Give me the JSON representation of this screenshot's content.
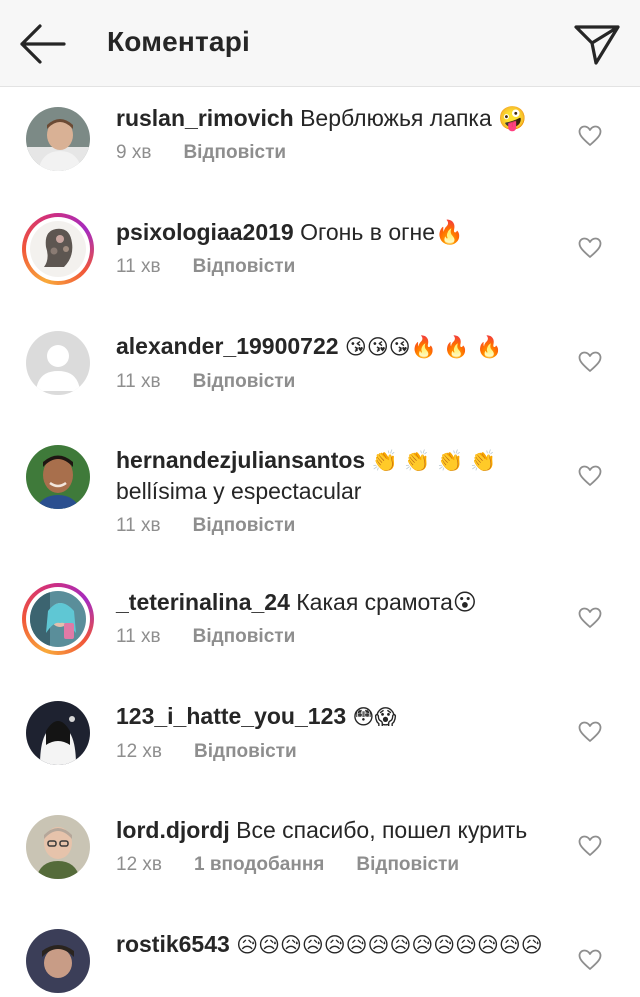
{
  "header": {
    "title": "Коментарі",
    "back_icon": "arrow-left-icon",
    "send_icon": "paper-plane-icon"
  },
  "comments": [
    {
      "username": "ruslan_rimovich",
      "text": "Верблюжья лапка 🤪",
      "time": "9 хв",
      "reply": "Відповісти",
      "likes": "",
      "story_ring": false,
      "avatar": "photo-avatar"
    },
    {
      "username": "psixologiaa2019",
      "text": "Огонь в огне🔥",
      "time": "11 хв",
      "reply": "Відповісти",
      "likes": "",
      "story_ring": true,
      "avatar": "photo-avatar"
    },
    {
      "username": "alexander_19900722",
      "text": "😘😘😘🔥 🔥 🔥",
      "time": "11 хв",
      "reply": "Відповісти",
      "likes": "",
      "story_ring": false,
      "avatar": "default-avatar"
    },
    {
      "username": "hernandezjuliansantos",
      "text": "👏 👏 👏 👏",
      "text2": "bellísima y espectacular",
      "time": "11 хв",
      "reply": "Відповісти",
      "likes": "",
      "story_ring": false,
      "avatar": "photo-avatar"
    },
    {
      "username": "_teterinalina_24",
      "text": "Какая срамота😮",
      "time": "11 хв",
      "reply": "Відповісти",
      "likes": "",
      "story_ring": true,
      "avatar": "photo-avatar"
    },
    {
      "username": "123_i_hatte_you_123",
      "text": "😳😱",
      "time": "12 хв",
      "reply": "Відповісти",
      "likes": "",
      "story_ring": false,
      "avatar": "photo-avatar"
    },
    {
      "username": "lord.djordj",
      "text": "Все спасибо, пошел курить",
      "time": "12 хв",
      "reply": "Відповісти",
      "likes": "1 вподобання",
      "story_ring": false,
      "avatar": "photo-avatar"
    },
    {
      "username": "rostik6543",
      "text": "😥😥😥😥😥😥😥😥😥😥😥😥😥😥",
      "time": "",
      "reply": "",
      "likes": "",
      "story_ring": false,
      "avatar": "photo-avatar"
    }
  ],
  "icons": {
    "heart": "heart-outline-icon"
  },
  "colors": {
    "text": "#262626",
    "meta": "#8e8e8e",
    "header_bg": "#f7f7f7"
  }
}
